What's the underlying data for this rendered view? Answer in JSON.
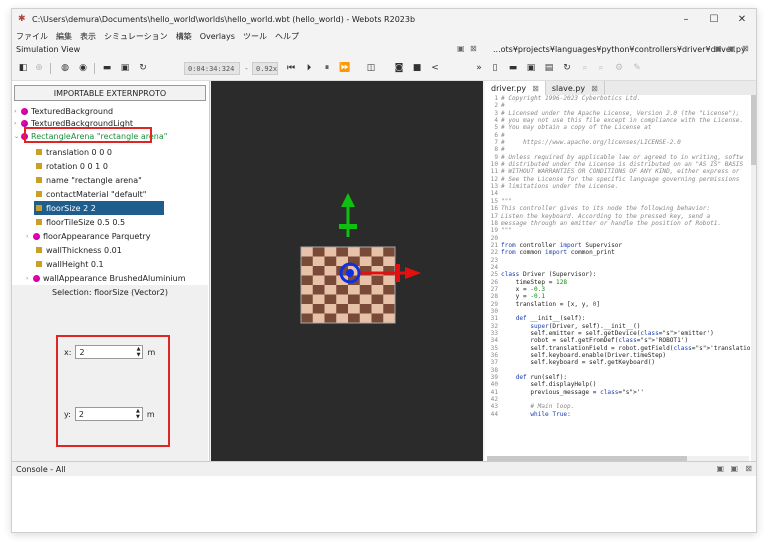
{
  "title": "C:\\Users\\demura\\Documents\\hello_world\\worlds\\hello_world.wbt (hello_world) - Webots R2023b",
  "menu": [
    "ファイル",
    "編集",
    "表示",
    "シミュレーション",
    "構築",
    "Overlays",
    "ツール",
    "ヘルプ"
  ],
  "sim_view_label": "Simulation View",
  "editor_path": "...ots¥projects¥languages¥python¥controllers¥driver¥driver.py",
  "time": "0:04:34:324",
  "speed": "0.92x",
  "extern_proto_label": "IMPORTABLE EXTERNPROTO",
  "tree": [
    {
      "label": "TexturedBackground",
      "kind": "proto",
      "arrow": "›"
    },
    {
      "label": "TexturedBackgroundLight",
      "kind": "proto",
      "arrow": "›"
    },
    {
      "label": "RectangleArena \"rectangle arena\"",
      "kind": "proto",
      "arrow": "⌄"
    },
    {
      "label": "translation 0 0 0",
      "kind": "field",
      "arrow": ""
    },
    {
      "label": "rotation 0 0 1 0",
      "kind": "field",
      "arrow": ""
    },
    {
      "label": "name \"rectangle arena\"",
      "kind": "field",
      "arrow": ""
    },
    {
      "label": "contactMaterial \"default\"",
      "kind": "field",
      "arrow": ""
    },
    {
      "label": "floorSize 2 2",
      "kind": "field",
      "arrow": ""
    },
    {
      "label": "floorTileSize 0.5 0.5",
      "kind": "field",
      "arrow": ""
    },
    {
      "label": "floorAppearance Parquetry",
      "kind": "proto",
      "arrow": "›"
    },
    {
      "label": "wallThickness 0.01",
      "kind": "field",
      "arrow": ""
    },
    {
      "label": "wallHeight 0.1",
      "kind": "field",
      "arrow": ""
    },
    {
      "label": "wallAppearance BrushedAluminium",
      "kind": "proto",
      "arrow": "›"
    }
  ],
  "selection": "Selection: floorSize (Vector2)",
  "field_x": {
    "label": "x:",
    "value": "2",
    "unit": "m"
  },
  "field_y": {
    "label": "y:",
    "value": "2",
    "unit": "m"
  },
  "tabs": [
    "driver.py",
    "slave.py"
  ],
  "console_title": "Console - All",
  "colors": {
    "highlight": "#e02525",
    "selected": "#1f5e8c",
    "floor_dark": "#7a4a38",
    "floor_light": "#e8c2a8"
  },
  "code": [
    [
      "c",
      "# Copyright 1996-2023 Cyberbotics Ltd."
    ],
    [
      "c",
      "#"
    ],
    [
      "c",
      "# Licensed under the Apache License, Version 2.0 (the \"License\");"
    ],
    [
      "c",
      "# you may not use this file except in compliance with the License."
    ],
    [
      "c",
      "# You may obtain a copy of the License at"
    ],
    [
      "c",
      "#"
    ],
    [
      "c",
      "#     https://www.apache.org/licenses/LICENSE-2.0"
    ],
    [
      "c",
      "#"
    ],
    [
      "c",
      "# Unless required by applicable law or agreed to in writing, softw"
    ],
    [
      "c",
      "# distributed under the License is distributed on an \"AS IS\" BASIS"
    ],
    [
      "c",
      "# WITHOUT WARRANTIES OR CONDITIONS OF ANY KIND, either express or"
    ],
    [
      "c",
      "# See the License for the specific language governing permissions"
    ],
    [
      "c",
      "# limitations under the License."
    ],
    [
      "p",
      ""
    ],
    [
      "c",
      "\"\"\""
    ],
    [
      "c",
      "This controller gives to its node the following behavior:"
    ],
    [
      "c",
      "Listen the keyboard. According to the pressed key, send a"
    ],
    [
      "c",
      "message through an emitter or handle the position of Robot1."
    ],
    [
      "c",
      "\"\"\""
    ],
    [
      "p",
      ""
    ],
    [
      "p",
      "from controller import Supervisor"
    ],
    [
      "p",
      "from common import common_print"
    ],
    [
      "p",
      ""
    ],
    [
      "p",
      ""
    ],
    [
      "p",
      "class Driver (Supervisor):"
    ],
    [
      "p",
      "    timeStep = 128"
    ],
    [
      "p",
      "    x = -0.3"
    ],
    [
      "p",
      "    y = -0.1"
    ],
    [
      "p",
      "    translation = [x, y, 0]"
    ],
    [
      "p",
      ""
    ],
    [
      "p",
      "    def __init__(self):"
    ],
    [
      "p",
      "        super(Driver, self).__init__()"
    ],
    [
      "p",
      "        self.emitter = self.getDevice('emitter')"
    ],
    [
      "p",
      "        robot = self.getFromDef('ROBOT1')"
    ],
    [
      "p",
      "        self.translationField = robot.getField('translation')"
    ],
    [
      "p",
      "        self.keyboard.enable(Driver.timeStep)"
    ],
    [
      "p",
      "        self.keyboard = self.getKeyboard()"
    ],
    [
      "p",
      ""
    ],
    [
      "p",
      "    def run(self):"
    ],
    [
      "p",
      "        self.displayHelp()"
    ],
    [
      "p",
      "        previous_message = ''"
    ],
    [
      "p",
      ""
    ],
    [
      "c",
      "        # Main loop."
    ],
    [
      "p",
      "        while True:"
    ]
  ]
}
